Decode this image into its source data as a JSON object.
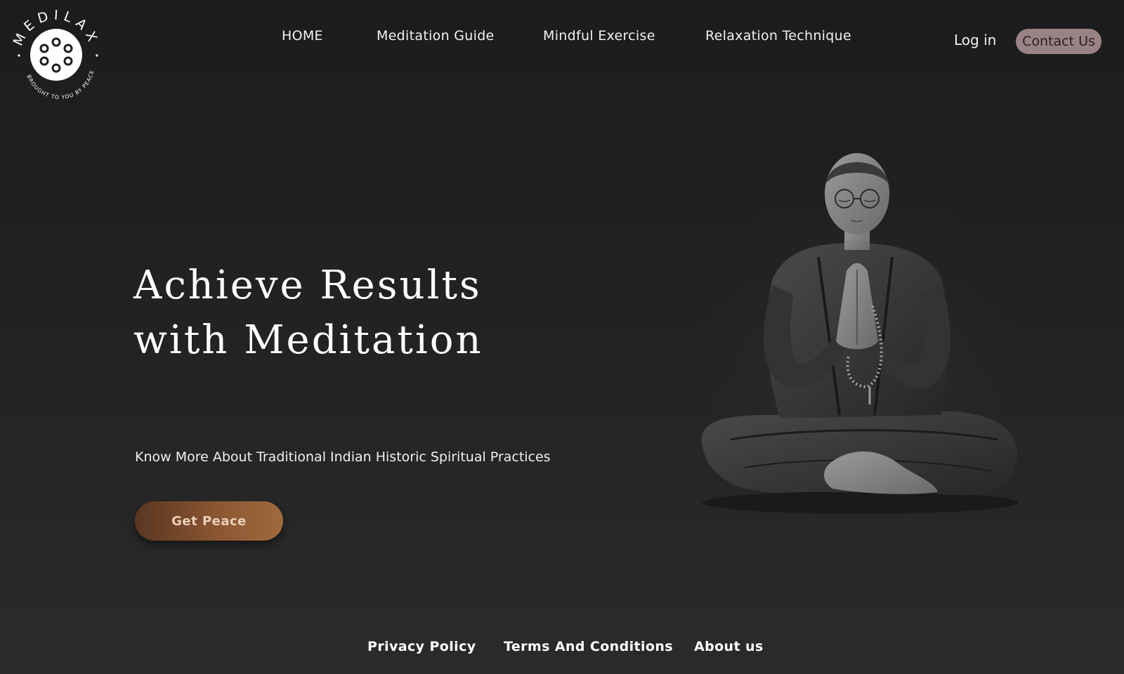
{
  "brand": {
    "name": "MEDILAX",
    "tagline": "BROUGHT TO YOU BY PEACE"
  },
  "nav": {
    "items": [
      {
        "label": "HOME"
      },
      {
        "label": "Meditation Guide"
      },
      {
        "label": "Mindful Exercise"
      },
      {
        "label": "Relaxation Technique"
      }
    ],
    "login_label": "Log in",
    "contact_label": "Contact Us"
  },
  "hero": {
    "title_line1": "Achieve Results",
    "title_line2": "with Meditation",
    "subtitle": "Know More About Traditional Indian Historic Spiritual Practices",
    "cta_label": "Get Peace"
  },
  "footer": {
    "links": [
      {
        "label": "Privacy Policy"
      },
      {
        "label": "Terms And Conditions"
      },
      {
        "label": "About us"
      }
    ]
  },
  "colors": {
    "background": "#1e1e1f",
    "contact_button": "#9a8384",
    "cta_gradient_start": "#5a3620",
    "cta_gradient_end": "#a06a3f",
    "cta_text": "#ecd0b8"
  },
  "icons": {
    "logo": "medilax-logo-icon",
    "hero_image": "meditating-man-illustration"
  }
}
